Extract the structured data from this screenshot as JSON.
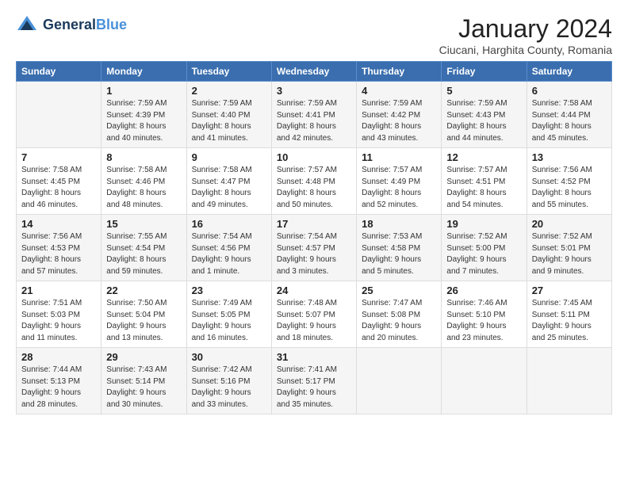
{
  "logo": {
    "line1": "General",
    "line2": "Blue"
  },
  "title": "January 2024",
  "location": "Ciucani, Harghita County, Romania",
  "weekdays": [
    "Sunday",
    "Monday",
    "Tuesday",
    "Wednesday",
    "Thursday",
    "Friday",
    "Saturday"
  ],
  "weeks": [
    [
      {
        "day": "",
        "sunrise": "",
        "sunset": "",
        "daylight": ""
      },
      {
        "day": "1",
        "sunrise": "Sunrise: 7:59 AM",
        "sunset": "Sunset: 4:39 PM",
        "daylight": "Daylight: 8 hours and 40 minutes."
      },
      {
        "day": "2",
        "sunrise": "Sunrise: 7:59 AM",
        "sunset": "Sunset: 4:40 PM",
        "daylight": "Daylight: 8 hours and 41 minutes."
      },
      {
        "day": "3",
        "sunrise": "Sunrise: 7:59 AM",
        "sunset": "Sunset: 4:41 PM",
        "daylight": "Daylight: 8 hours and 42 minutes."
      },
      {
        "day": "4",
        "sunrise": "Sunrise: 7:59 AM",
        "sunset": "Sunset: 4:42 PM",
        "daylight": "Daylight: 8 hours and 43 minutes."
      },
      {
        "day": "5",
        "sunrise": "Sunrise: 7:59 AM",
        "sunset": "Sunset: 4:43 PM",
        "daylight": "Daylight: 8 hours and 44 minutes."
      },
      {
        "day": "6",
        "sunrise": "Sunrise: 7:58 AM",
        "sunset": "Sunset: 4:44 PM",
        "daylight": "Daylight: 8 hours and 45 minutes."
      }
    ],
    [
      {
        "day": "7",
        "sunrise": "Sunrise: 7:58 AM",
        "sunset": "Sunset: 4:45 PM",
        "daylight": "Daylight: 8 hours and 46 minutes."
      },
      {
        "day": "8",
        "sunrise": "Sunrise: 7:58 AM",
        "sunset": "Sunset: 4:46 PM",
        "daylight": "Daylight: 8 hours and 48 minutes."
      },
      {
        "day": "9",
        "sunrise": "Sunrise: 7:58 AM",
        "sunset": "Sunset: 4:47 PM",
        "daylight": "Daylight: 8 hours and 49 minutes."
      },
      {
        "day": "10",
        "sunrise": "Sunrise: 7:57 AM",
        "sunset": "Sunset: 4:48 PM",
        "daylight": "Daylight: 8 hours and 50 minutes."
      },
      {
        "day": "11",
        "sunrise": "Sunrise: 7:57 AM",
        "sunset": "Sunset: 4:49 PM",
        "daylight": "Daylight: 8 hours and 52 minutes."
      },
      {
        "day": "12",
        "sunrise": "Sunrise: 7:57 AM",
        "sunset": "Sunset: 4:51 PM",
        "daylight": "Daylight: 8 hours and 54 minutes."
      },
      {
        "day": "13",
        "sunrise": "Sunrise: 7:56 AM",
        "sunset": "Sunset: 4:52 PM",
        "daylight": "Daylight: 8 hours and 55 minutes."
      }
    ],
    [
      {
        "day": "14",
        "sunrise": "Sunrise: 7:56 AM",
        "sunset": "Sunset: 4:53 PM",
        "daylight": "Daylight: 8 hours and 57 minutes."
      },
      {
        "day": "15",
        "sunrise": "Sunrise: 7:55 AM",
        "sunset": "Sunset: 4:54 PM",
        "daylight": "Daylight: 8 hours and 59 minutes."
      },
      {
        "day": "16",
        "sunrise": "Sunrise: 7:54 AM",
        "sunset": "Sunset: 4:56 PM",
        "daylight": "Daylight: 9 hours and 1 minute."
      },
      {
        "day": "17",
        "sunrise": "Sunrise: 7:54 AM",
        "sunset": "Sunset: 4:57 PM",
        "daylight": "Daylight: 9 hours and 3 minutes."
      },
      {
        "day": "18",
        "sunrise": "Sunrise: 7:53 AM",
        "sunset": "Sunset: 4:58 PM",
        "daylight": "Daylight: 9 hours and 5 minutes."
      },
      {
        "day": "19",
        "sunrise": "Sunrise: 7:52 AM",
        "sunset": "Sunset: 5:00 PM",
        "daylight": "Daylight: 9 hours and 7 minutes."
      },
      {
        "day": "20",
        "sunrise": "Sunrise: 7:52 AM",
        "sunset": "Sunset: 5:01 PM",
        "daylight": "Daylight: 9 hours and 9 minutes."
      }
    ],
    [
      {
        "day": "21",
        "sunrise": "Sunrise: 7:51 AM",
        "sunset": "Sunset: 5:03 PM",
        "daylight": "Daylight: 9 hours and 11 minutes."
      },
      {
        "day": "22",
        "sunrise": "Sunrise: 7:50 AM",
        "sunset": "Sunset: 5:04 PM",
        "daylight": "Daylight: 9 hours and 13 minutes."
      },
      {
        "day": "23",
        "sunrise": "Sunrise: 7:49 AM",
        "sunset": "Sunset: 5:05 PM",
        "daylight": "Daylight: 9 hours and 16 minutes."
      },
      {
        "day": "24",
        "sunrise": "Sunrise: 7:48 AM",
        "sunset": "Sunset: 5:07 PM",
        "daylight": "Daylight: 9 hours and 18 minutes."
      },
      {
        "day": "25",
        "sunrise": "Sunrise: 7:47 AM",
        "sunset": "Sunset: 5:08 PM",
        "daylight": "Daylight: 9 hours and 20 minutes."
      },
      {
        "day": "26",
        "sunrise": "Sunrise: 7:46 AM",
        "sunset": "Sunset: 5:10 PM",
        "daylight": "Daylight: 9 hours and 23 minutes."
      },
      {
        "day": "27",
        "sunrise": "Sunrise: 7:45 AM",
        "sunset": "Sunset: 5:11 PM",
        "daylight": "Daylight: 9 hours and 25 minutes."
      }
    ],
    [
      {
        "day": "28",
        "sunrise": "Sunrise: 7:44 AM",
        "sunset": "Sunset: 5:13 PM",
        "daylight": "Daylight: 9 hours and 28 minutes."
      },
      {
        "day": "29",
        "sunrise": "Sunrise: 7:43 AM",
        "sunset": "Sunset: 5:14 PM",
        "daylight": "Daylight: 9 hours and 30 minutes."
      },
      {
        "day": "30",
        "sunrise": "Sunrise: 7:42 AM",
        "sunset": "Sunset: 5:16 PM",
        "daylight": "Daylight: 9 hours and 33 minutes."
      },
      {
        "day": "31",
        "sunrise": "Sunrise: 7:41 AM",
        "sunset": "Sunset: 5:17 PM",
        "daylight": "Daylight: 9 hours and 35 minutes."
      },
      {
        "day": "",
        "sunrise": "",
        "sunset": "",
        "daylight": ""
      },
      {
        "day": "",
        "sunrise": "",
        "sunset": "",
        "daylight": ""
      },
      {
        "day": "",
        "sunrise": "",
        "sunset": "",
        "daylight": ""
      }
    ]
  ]
}
